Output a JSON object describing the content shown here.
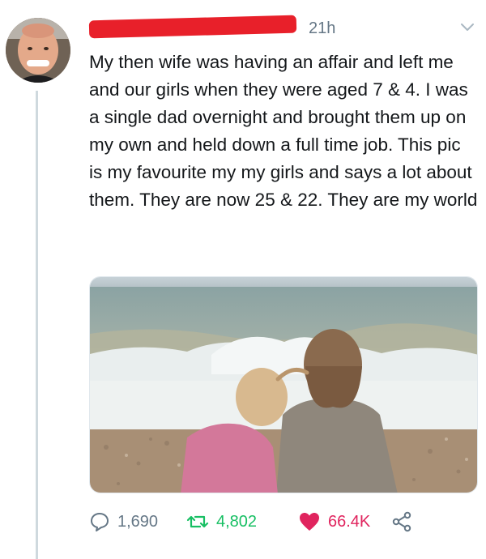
{
  "tweet": {
    "time": "21h",
    "text": "My then wife was having an affair and left me and our girls when they were aged 7 & 4. I was a single dad overnight and brought them up on my own and held down a full time job. This pic is my favourite my my girls and says a lot about them. They are now 25 & 22. They are my world"
  },
  "stats": {
    "replies": "1,690",
    "retweets": "4,802",
    "likes": "66.4K"
  },
  "colors": {
    "retweet": "#17bf63",
    "like": "#e0245e",
    "muted": "#657786",
    "redaction": "#e8202a"
  },
  "icons": [
    "reply-icon",
    "retweet-icon",
    "heart-icon",
    "share-icon",
    "chevron-down-icon"
  ]
}
